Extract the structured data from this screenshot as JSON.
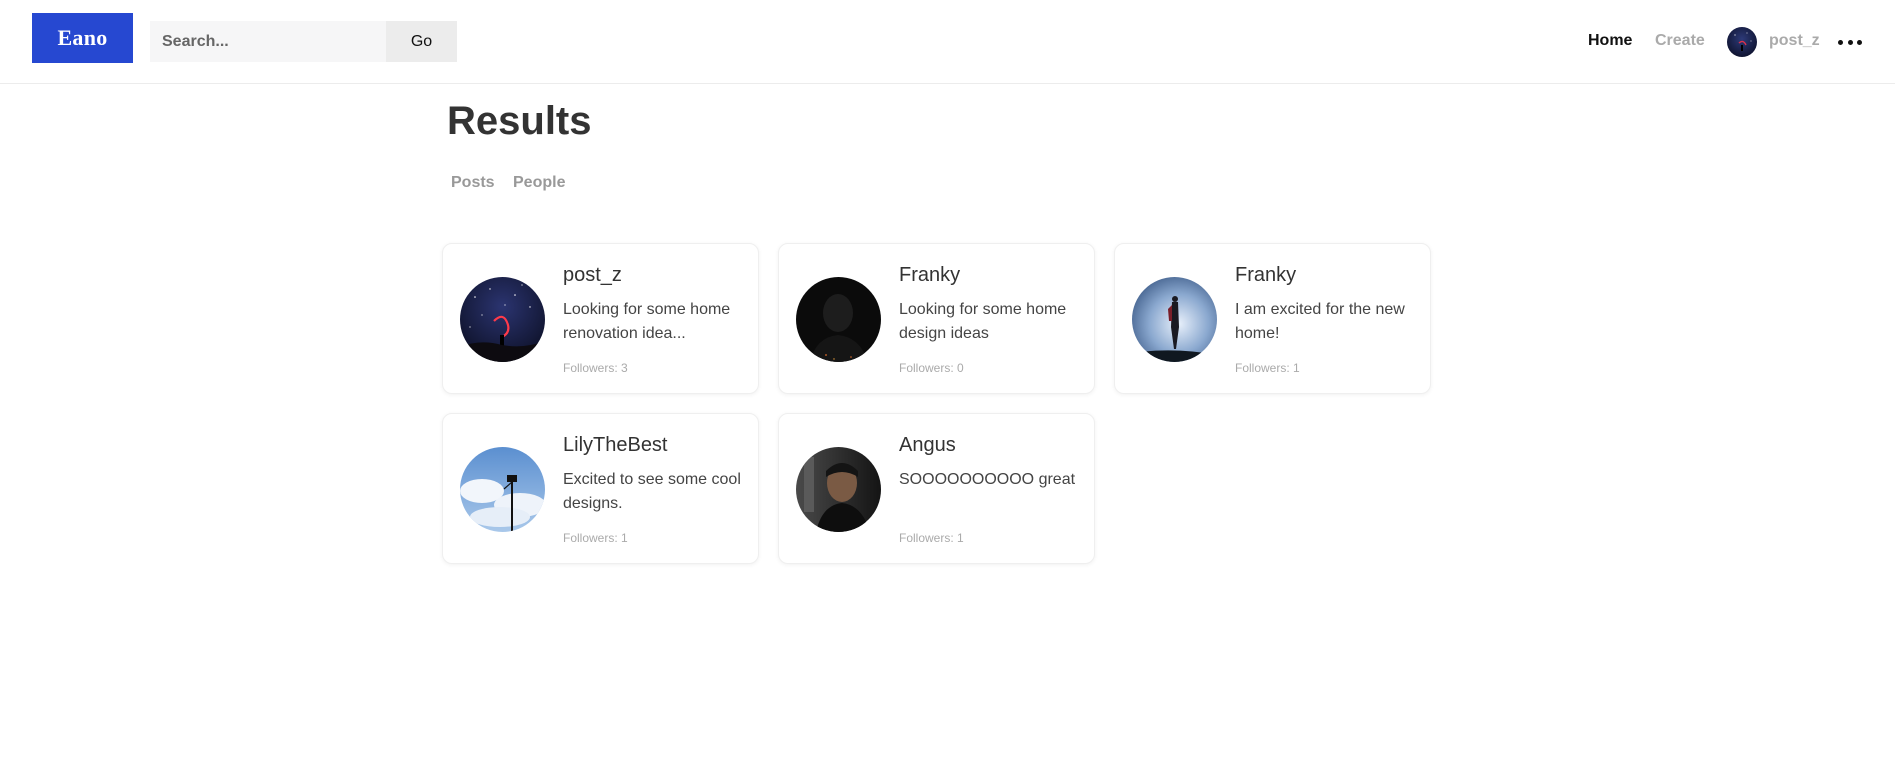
{
  "app": {
    "logo": "Eano"
  },
  "header": {
    "search_placeholder": "Search...",
    "go_label": "Go",
    "nav": {
      "home": "Home",
      "create": "Create",
      "username": "post_z"
    }
  },
  "main": {
    "title": "Results",
    "tabs": [
      "Posts",
      "People"
    ],
    "cards": [
      {
        "name": "post_z",
        "bio": "Looking for some home renovation idea...",
        "followers": "Followers: 3",
        "avatar": "night-sky-photo"
      },
      {
        "name": "Franky",
        "bio": "Looking for some home design ideas",
        "followers": "Followers: 0",
        "avatar": "dark-portrait-photo"
      },
      {
        "name": "Franky",
        "bio": "I am excited for the new home!",
        "followers": "Followers: 1",
        "avatar": "silhouette-sky-photo"
      },
      {
        "name": "LilyTheBest",
        "bio": "Excited to see some cool designs.",
        "followers": "Followers: 1",
        "avatar": "lamp-post-sky-photo"
      },
      {
        "name": "Angus",
        "bio": "SOOOOOOOOOO great",
        "followers": "Followers: 1",
        "avatar": "portrait-photo"
      }
    ]
  },
  "colors": {
    "brand": "#2648d1",
    "muted": "#aaaaaa",
    "text": "#333333"
  }
}
